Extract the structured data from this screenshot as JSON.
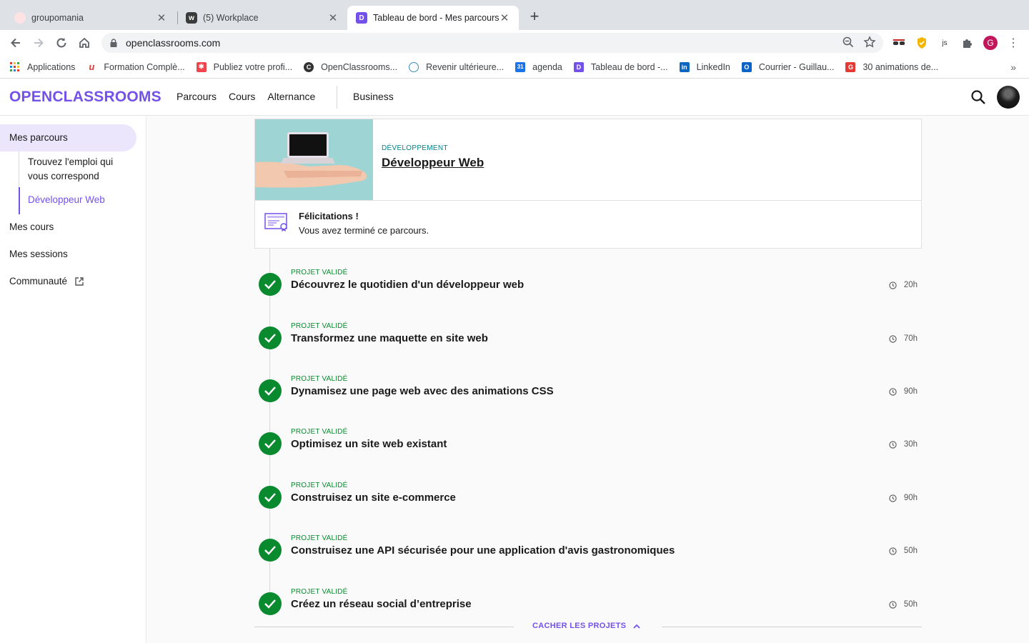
{
  "browser": {
    "tabs": [
      {
        "title": "groupomania",
        "active": false
      },
      {
        "title": "(5) Workplace",
        "active": false
      },
      {
        "title": "Tableau de bord - Mes parcours",
        "active": true
      }
    ],
    "url": "openclassrooms.com",
    "profile_initial": "G",
    "bookmarks": [
      {
        "label": "Applications",
        "icon": "apps-grid-icon"
      },
      {
        "label": "Formation Complè...",
        "icon": "udemy-icon"
      },
      {
        "label": "Publiez votre profi...",
        "icon": "malt-icon"
      },
      {
        "label": "OpenClassrooms...",
        "icon": "openclassrooms-icon"
      },
      {
        "label": "Revenir ultérieure...",
        "icon": "react-icon"
      },
      {
        "label": "agenda",
        "icon": "calendar-icon"
      },
      {
        "label": "Tableau de bord -...",
        "icon": "openclassrooms-icon"
      },
      {
        "label": "LinkedIn",
        "icon": "linkedin-icon"
      },
      {
        "label": "Courrier - Guillau...",
        "icon": "outlook-icon"
      },
      {
        "label": "30 animations de...",
        "icon": "g-icon"
      }
    ],
    "calendar_badge": "31",
    "bookmarks_more": "»"
  },
  "header": {
    "logo": "OPENCLASSROOMS",
    "nav": [
      "Parcours",
      "Cours",
      "Alternance"
    ],
    "business": "Business"
  },
  "sidebar": {
    "active": "Mes parcours",
    "sub_items": [
      "Trouvez l'emploi qui vous correspond",
      "Développeur Web"
    ],
    "items": [
      "Mes cours",
      "Mes sessions",
      "Communauté"
    ]
  },
  "path_card": {
    "category": "DÉVELOPPEMENT",
    "title": "Développeur Web",
    "congrats_title": "Félicitations !",
    "congrats_text": "Vous avez terminé ce parcours."
  },
  "projects": [
    {
      "status": "PROJET VALIDÉ",
      "name": "Découvrez le quotidien d'un développeur web",
      "duration": "20h"
    },
    {
      "status": "PROJET VALIDÉ",
      "name": "Transformez une maquette en site web",
      "duration": "70h"
    },
    {
      "status": "PROJET VALIDÉ",
      "name": "Dynamisez une page web avec des animations CSS",
      "duration": "90h"
    },
    {
      "status": "PROJET VALIDÉ",
      "name": "Optimisez un site web existant",
      "duration": "30h"
    },
    {
      "status": "PROJET VALIDÉ",
      "name": "Construisez un site e-commerce",
      "duration": "90h"
    },
    {
      "status": "PROJET VALIDÉ",
      "name": "Construisez une API sécurisée pour une application d'avis gastronomiques",
      "duration": "50h"
    },
    {
      "status": "PROJET VALIDÉ",
      "name": "Créez un réseau social d’entreprise",
      "duration": "50h"
    }
  ],
  "hide_projects": "CACHER LES PROJETS",
  "colors": {
    "brand": "#7451eb",
    "success": "#0a8a2f",
    "category": "#00828c"
  }
}
